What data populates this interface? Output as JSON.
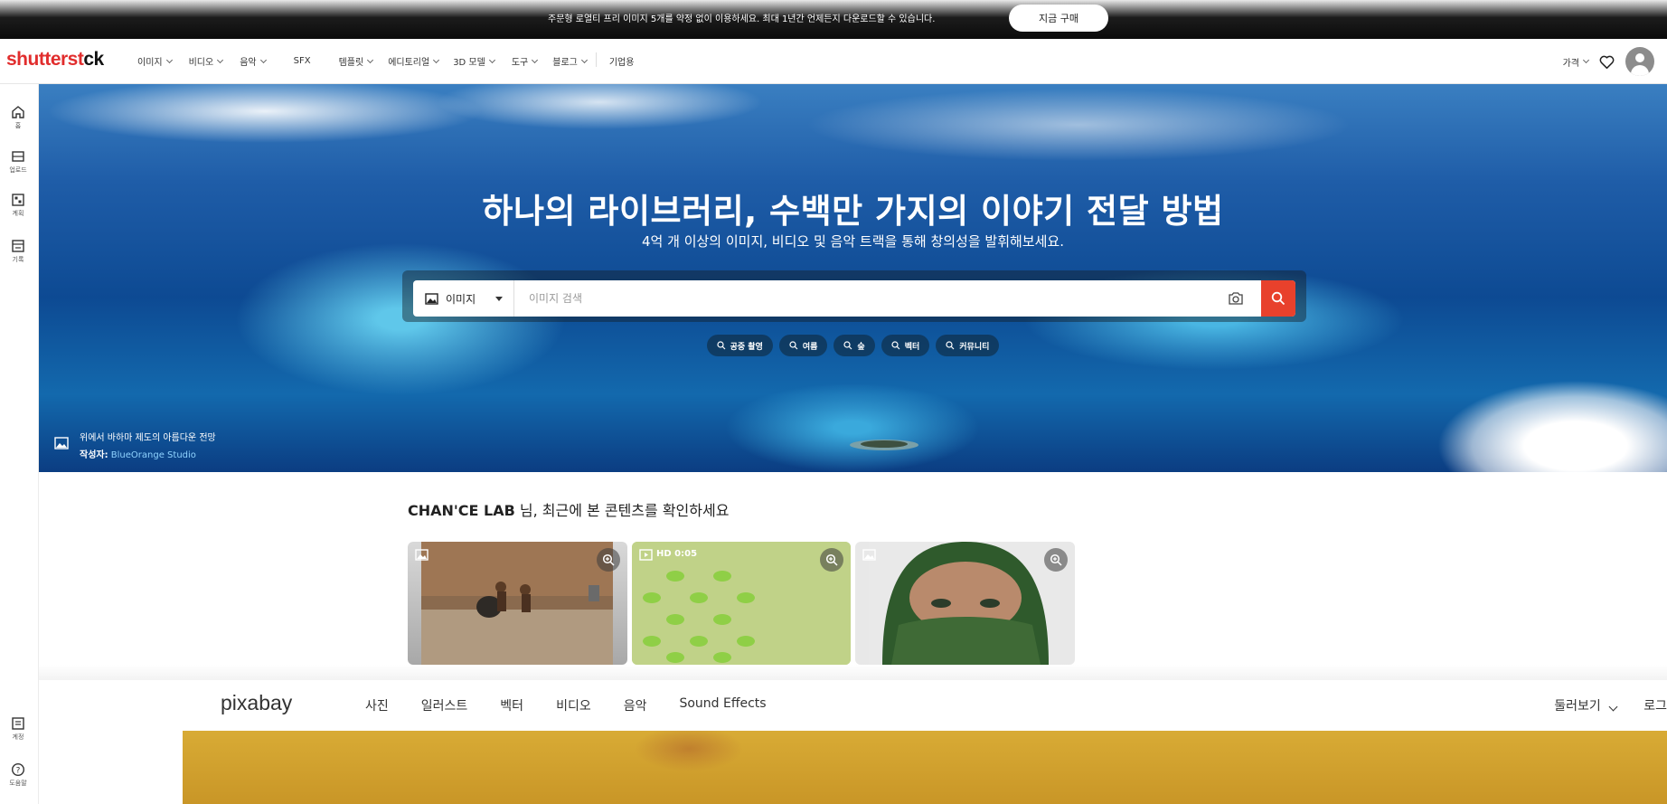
{
  "promo": {
    "text": "주문형 로열티 프리 이미지 5개를 약정 없이 이용하세요. 최대 1년간 언제든지 다운로드할 수 있습니다.",
    "button": "지금 구매"
  },
  "logo": {
    "part1": "shutterst",
    "part2": "ck",
    "icon": "shutterstock-o-icon"
  },
  "nav": {
    "items": [
      {
        "label": "이미지",
        "dropdown": true
      },
      {
        "label": "비디오",
        "dropdown": true
      },
      {
        "label": "음악",
        "dropdown": true
      },
      {
        "label": "SFX",
        "dropdown": false
      },
      {
        "label": "템플릿",
        "dropdown": true
      },
      {
        "label": "에디토리얼",
        "dropdown": true
      },
      {
        "label": "3D 모델",
        "dropdown": true
      },
      {
        "label": "도구",
        "dropdown": true
      },
      {
        "label": "블로그",
        "dropdown": true
      }
    ],
    "enterprise": "기업용",
    "pricing": "가격"
  },
  "sidebar": {
    "items": [
      {
        "label": "홈",
        "icon": "home-icon"
      },
      {
        "label": "업로드",
        "icon": "upload-icon"
      },
      {
        "label": "계획",
        "icon": "plan-icon"
      },
      {
        "label": "기록",
        "icon": "history-icon"
      }
    ],
    "bottom": [
      {
        "label": "계정",
        "icon": "account-icon"
      },
      {
        "label": "도움말",
        "icon": "help-icon"
      }
    ]
  },
  "hero": {
    "title": "하나의 라이브러리, 수백만 가지의 이야기 전달 방법",
    "subtitle": "4억 개 이상의 이미지, 비디오 및 음악 트랙을 통해 창의성을 발휘해보세요.",
    "search": {
      "type": "이미지",
      "placeholder": "이미지 검색"
    },
    "chips": [
      "공중 촬영",
      "여름",
      "숲",
      "벡터",
      "커뮤니티"
    ],
    "credit": {
      "caption": "위에서 바하마 제도의 아름다운 전망",
      "by_label": "작성자:",
      "author": "BlueOrange Studio"
    }
  },
  "recent": {
    "user": "CHAN'CE LAB",
    "title": " 님, 최근에 본 콘텐츠를 확인하세요",
    "cards": [
      {
        "type": "image",
        "icon": "image-icon"
      },
      {
        "type": "video",
        "icon": "video-icon",
        "badge": "HD 0:05"
      },
      {
        "type": "image",
        "icon": "image-icon"
      }
    ]
  },
  "pixabay": {
    "logo": "pixabay",
    "nav": [
      "사진",
      "일러스트",
      "벡터",
      "비디오",
      "음악",
      "Sound Effects"
    ],
    "explore": "둘러보기",
    "login": "로그"
  },
  "colors": {
    "brand_red": "#e12d2d",
    "search_button": "#e8412c",
    "credit_link": "#8fd3ff"
  }
}
